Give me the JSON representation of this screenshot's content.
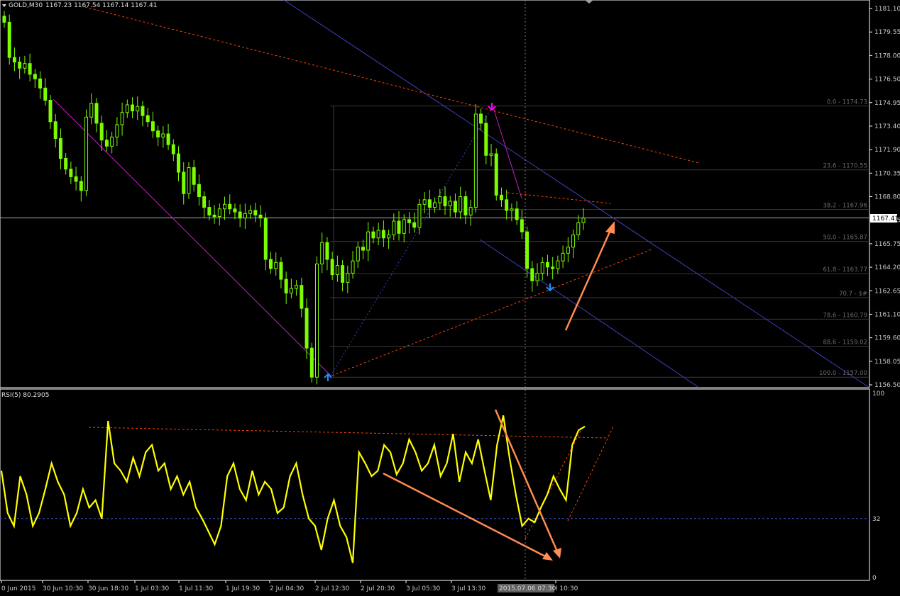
{
  "header": {
    "symbol_label": "GOLD,M30",
    "ohlc": "1167.23 1167.54 1167.14 1167.41"
  },
  "rsi_header": "RSI(5) 80.2905",
  "current_price_label": "1167.41",
  "crosshair_time_label": "2015.07.06 07:30",
  "colors": {
    "background": "#000000",
    "candle": "#7CFC00",
    "rsi_line": "#FFFF00",
    "channel": "#4040C0",
    "trendline": "#FF4500",
    "fib_level": "#3A3A3A",
    "arrow": "#FF8C50",
    "zigzag": "#C020C0",
    "marker_up": "#1E90FF",
    "marker_down": "#FF00FF"
  },
  "chart_data": [
    {
      "type": "candlestick",
      "symbol": "GOLD",
      "timeframe": "M30",
      "y_tick_labels": [
        "1181.10",
        "1179.55",
        "1178.00",
        "1176.50",
        "1174.95",
        "1173.40",
        "1171.90",
        "1170.35",
        "1168.80",
        "1167.25",
        "1165.75",
        "1164.20",
        "1162.65",
        "1161.10",
        "1159.60",
        "1158.05",
        "1156.50"
      ],
      "ylim": [
        1156.5,
        1181.1
      ],
      "x_tick_labels": [
        "0 Jun 2015",
        "30 Jun 10:30",
        "30 Jun 18:30",
        "1 Jul 03:30",
        "1 Jul 11:30",
        "1 Jul 19:30",
        "2 Jul 04:30",
        "2 Jul 12:30",
        "2 Jul 20:30",
        "3 Jul 05:30",
        "3 Jul 13:30",
        "2015.07.06 07:30",
        "l 10:30"
      ],
      "fibonacci_levels": [
        {
          "label": "0.0 - 1174.73",
          "value": 1174.73
        },
        {
          "label": "23.6 - 1170.55",
          "value": 1170.55
        },
        {
          "label": "38.2 - 1167.96",
          "value": 1167.96
        },
        {
          "label": "50.0 - 1165.87",
          "value": 1165.87
        },
        {
          "label": "61.8 - 1163.77",
          "value": 1163.77
        },
        {
          "label": "70.7 - $#",
          "value": 1162.2
        },
        {
          "label": "78.6 - 1160.79",
          "value": 1160.79
        },
        {
          "label": "88.6 - 1159.02",
          "value": 1159.02
        },
        {
          "label": "100.0 - 1157.00",
          "value": 1157.0
        }
      ],
      "close_series": [
        1180.2,
        1177.9,
        1177.6,
        1177.2,
        1177.5,
        1176.8,
        1176.5,
        1175.9,
        1175.1,
        1173.7,
        1172.6,
        1171.3,
        1170.6,
        1170.1,
        1169.8,
        1169.2,
        1174.0,
        1174.9,
        1173.6,
        1172.5,
        1172.1,
        1172.7,
        1173.5,
        1174.3,
        1174.8,
        1174.4,
        1174.7,
        1174.1,
        1173.7,
        1173.1,
        1172.7,
        1172.9,
        1172.2,
        1171.6,
        1170.4,
        1169.0,
        1170.7,
        1169.6,
        1168.8,
        1168.1,
        1167.6,
        1167.5,
        1168.0,
        1168.3,
        1168.0,
        1167.8,
        1167.4,
        1167.7,
        1167.9,
        1167.6,
        1167.4,
        1164.7,
        1164.1,
        1164.5,
        1163.4,
        1162.5,
        1162.8,
        1163.0,
        1161.5,
        1158.9,
        1157.0,
        1164.4,
        1165.8,
        1164.7,
        1163.7,
        1164.3,
        1163.2,
        1163.8,
        1164.6,
        1165.5,
        1165.3,
        1166.5,
        1166.1,
        1166.6,
        1166.1,
        1166.3,
        1167.2,
        1166.4,
        1167.3,
        1167.1,
        1166.8,
        1168.3,
        1168.6,
        1168.1,
        1168.4,
        1168.8,
        1168.2,
        1168.5,
        1167.8,
        1168.8,
        1167.6,
        1168.1,
        1174.2,
        1173.6,
        1171.5,
        1171.6,
        1168.9,
        1168.6,
        1167.9,
        1168.0,
        1167.3,
        1166.5,
        1164.1,
        1163.3,
        1163.8,
        1164.5,
        1164.2,
        1164.1,
        1164.6,
        1165.1,
        1165.5,
        1166.3,
        1167.1,
        1167.4
      ]
    },
    {
      "type": "line",
      "indicator": "RSI(5)",
      "last_value": 80.2905,
      "ylim": [
        0,
        100
      ],
      "y_tick_labels": [
        "100",
        "32",
        "0"
      ],
      "level": 32,
      "values": [
        58,
        35,
        28,
        55,
        45,
        28,
        35,
        48,
        62,
        52,
        45,
        28,
        35,
        48,
        38,
        42,
        32,
        85,
        62,
        58,
        52,
        65,
        55,
        68,
        72,
        58,
        62,
        48,
        55,
        45,
        52,
        38,
        32,
        25,
        18,
        28,
        55,
        62,
        48,
        42,
        58,
        45,
        52,
        48,
        35,
        38,
        55,
        62,
        45,
        32,
        28,
        15,
        32,
        42,
        28,
        22,
        8,
        68,
        62,
        55,
        58,
        72,
        68,
        56,
        62,
        75,
        68,
        58,
        62,
        72,
        55,
        62,
        78,
        52,
        68,
        62,
        75,
        58,
        42,
        72,
        88,
        65,
        45,
        28,
        32,
        30,
        38,
        45,
        55,
        48,
        42,
        72,
        80,
        82
      ]
    }
  ]
}
